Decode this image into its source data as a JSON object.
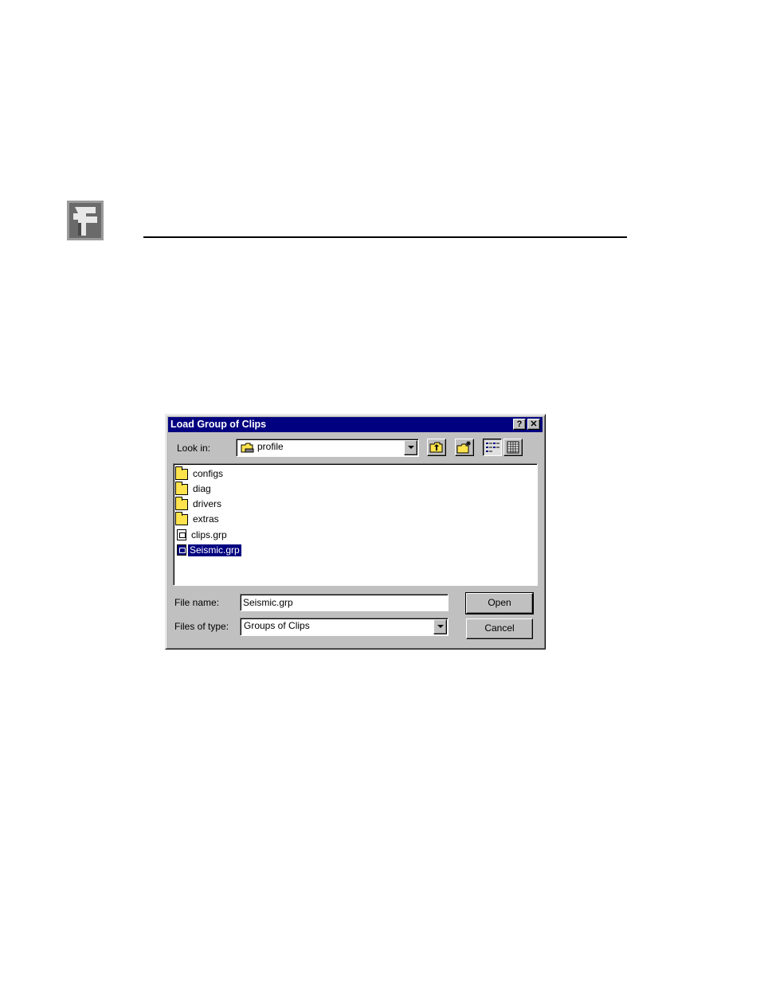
{
  "dialog": {
    "title": "Load Group of Clips",
    "help_glyph": "?",
    "close_glyph": "✕",
    "look_in_label": "Look in:",
    "look_in_value": "profile",
    "toolbar_icons": [
      "up-one-level-icon",
      "new-folder-icon",
      "list-view-icon",
      "details-view-icon"
    ],
    "files": [
      {
        "name": "configs",
        "icon": "folder-icon"
      },
      {
        "name": "diag",
        "icon": "folder-icon"
      },
      {
        "name": "drivers",
        "icon": "folder-icon"
      },
      {
        "name": "extras",
        "icon": "folder-icon"
      },
      {
        "name": "clips.grp",
        "icon": "document-icon"
      },
      {
        "name": "Seismic.grp",
        "icon": "document-icon",
        "selected": true
      }
    ],
    "file_name_label": "File name:",
    "file_name_value": "Seismic.grp",
    "file_type_label": "Files of type:",
    "file_type_value": "Groups of Clips",
    "open_label": "Open",
    "cancel_label": "Cancel"
  },
  "colors": {
    "titlebar": "#000080",
    "dialog_face": "#c0c0c0",
    "selection": "#000080"
  }
}
